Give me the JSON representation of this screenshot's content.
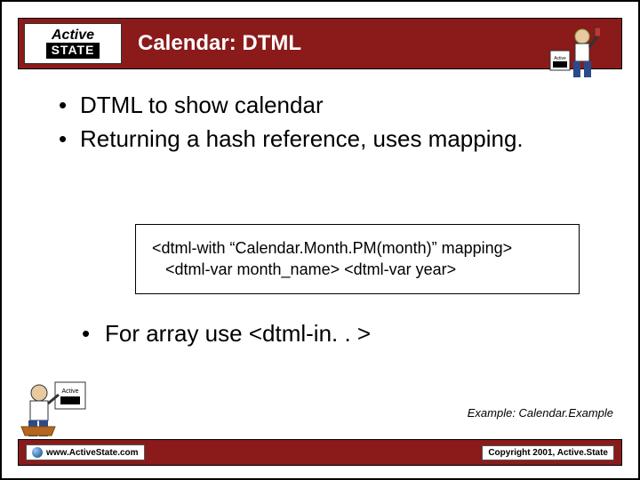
{
  "logo": {
    "top": "Active",
    "bottom": "STATE"
  },
  "title": "Calendar: DTML",
  "bullets": [
    "DTML to show calendar",
    "Returning a hash reference, uses mapping."
  ],
  "code": {
    "line1": "<dtml-with “Calendar.Month.PM(month)” mapping>",
    "line2": "   <dtml-var month_name> <dtml-var year>"
  },
  "sub_bullet": "For array use <dtml-in. . >",
  "example_note": "Example: Calendar.Example",
  "footer": {
    "url": "www.ActiveState.com",
    "copyright": "Copyright 2001, Active.State"
  }
}
